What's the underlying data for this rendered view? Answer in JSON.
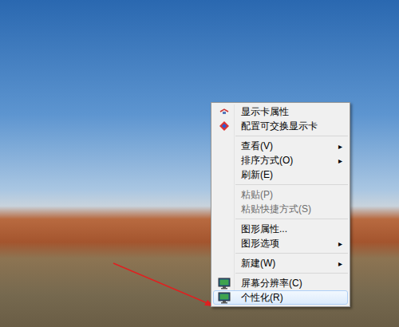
{
  "desktop": {
    "wallpaper": "photo"
  },
  "context_menu": {
    "items": [
      {
        "kind": "item",
        "label": "显示卡属性",
        "disabled": false,
        "selected": false
      },
      {
        "kind": "item",
        "label": "配置可交换显示卡",
        "disabled": false,
        "selected": false
      },
      {
        "kind": "separator"
      },
      {
        "kind": "item",
        "label": "查看(V)",
        "disabled": false,
        "selected": false,
        "arrow": "▸"
      },
      {
        "kind": "item",
        "label": "排序方式(O)",
        "disabled": false,
        "selected": false,
        "arrow": "▸"
      },
      {
        "kind": "item",
        "label": "刷新(E)",
        "disabled": false,
        "selected": false
      },
      {
        "kind": "separator"
      },
      {
        "kind": "item",
        "label": "粘贴(P)",
        "disabled": true,
        "selected": false
      },
      {
        "kind": "item",
        "label": "粘贴快捷方式(S)",
        "disabled": true,
        "selected": false
      },
      {
        "kind": "separator"
      },
      {
        "kind": "item",
        "label": "图形属性...",
        "disabled": false,
        "selected": false
      },
      {
        "kind": "item",
        "label": "图形选项",
        "disabled": false,
        "selected": false,
        "arrow": "▸"
      },
      {
        "kind": "separator"
      },
      {
        "kind": "item",
        "label": "新建(W)",
        "disabled": false,
        "selected": false,
        "arrow": "▸"
      },
      {
        "kind": "separator"
      },
      {
        "kind": "item",
        "label": "屏幕分辨率(C)",
        "disabled": false,
        "selected": false
      },
      {
        "kind": "item",
        "label": "个性化(R)",
        "disabled": false,
        "selected": true
      }
    ]
  }
}
